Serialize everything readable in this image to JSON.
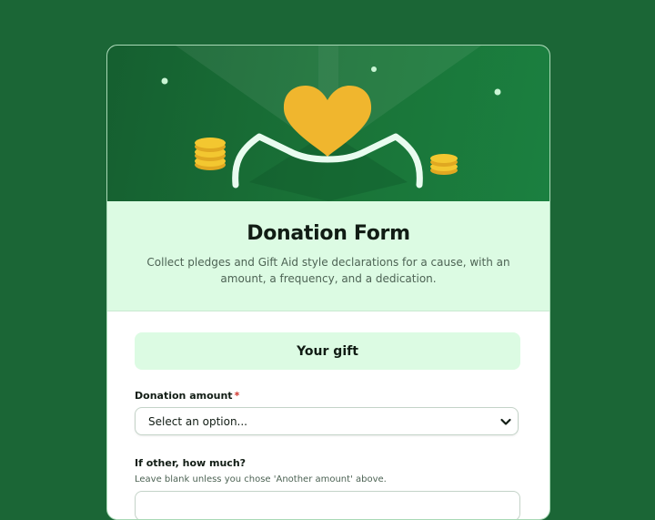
{
  "form": {
    "title": "Donation Form",
    "description": "Collect pledges and Gift Aid style declarations for a cause, with an amount, a frequency, and a dedication."
  },
  "sections": [
    {
      "heading": "Your gift",
      "fields": [
        {
          "label": "Donation amount",
          "required": true,
          "required_marker": "*",
          "type": "select",
          "value": "Select an option..."
        },
        {
          "label": "If other, how much?",
          "required": false,
          "hint": "Leave blank unless you chose 'Another amount' above."
        }
      ]
    }
  ],
  "colors": {
    "page_background": "#1b6636",
    "banner_green": "#1a7438",
    "intro_background": "#dcfbe3",
    "heart": "#f0b62e",
    "coin": "#f3c730",
    "required_marker": "#d0342c"
  },
  "icons": {
    "banner": [
      "heart-icon",
      "hands-icon",
      "coin-stack-icon",
      "sparkle-dot-icon"
    ],
    "select": "chevron-down-icon"
  }
}
